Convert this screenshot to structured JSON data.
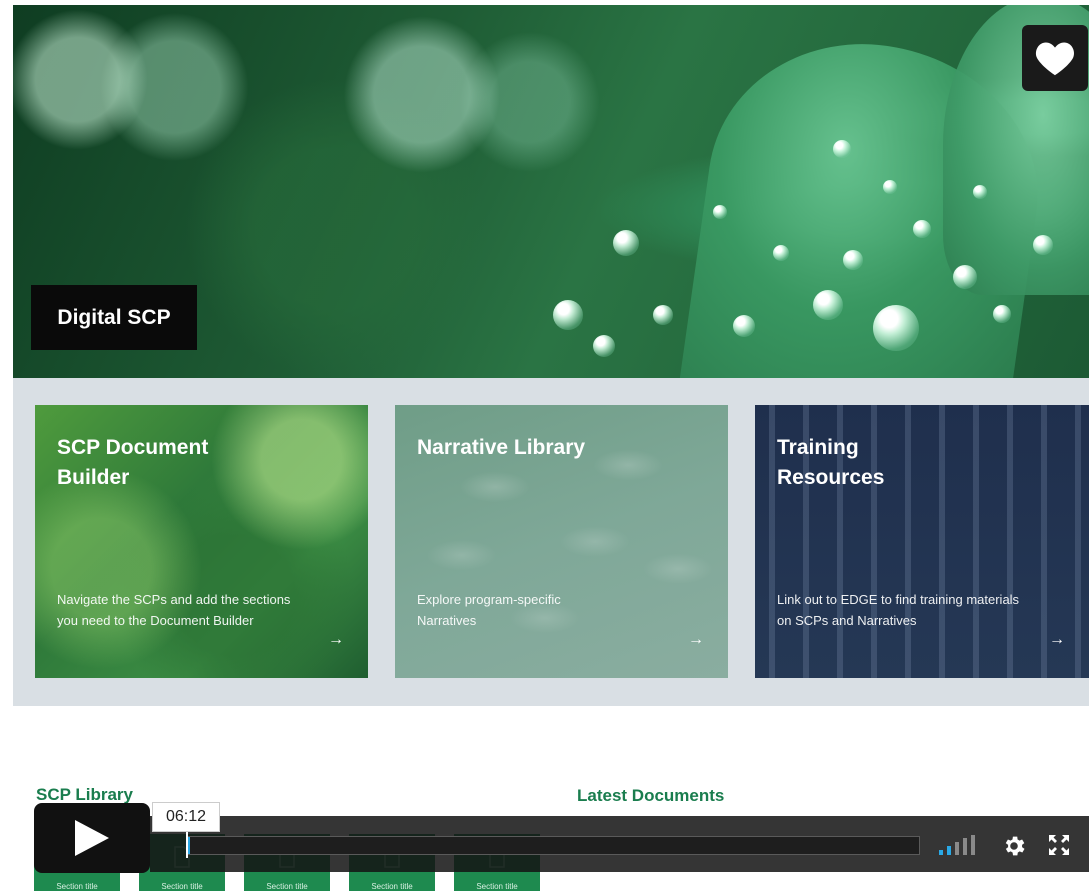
{
  "hero": {
    "title": "Digital SCP",
    "like_icon": "heart-icon"
  },
  "cards": [
    {
      "title": "SCP Document Builder",
      "description": "Navigate the SCPs and add the sections you need to the Document Builder",
      "arrow": "→"
    },
    {
      "title": "Narrative Library",
      "description": "Explore program-specific Narratives",
      "arrow": "→"
    },
    {
      "title": "Training Resources",
      "description": "Link out to EDGE to find training materials on SCPs and Narratives",
      "arrow": "→"
    }
  ],
  "library": {
    "heading": "SCP Library",
    "tiles": [
      "Section title",
      "Section title",
      "Section title",
      "Section title",
      "Section title"
    ]
  },
  "latest": {
    "heading": "Latest Documents"
  },
  "player": {
    "time": "06:12",
    "progress": 0.002,
    "volume_level": 0.4,
    "accent_color": "#2aa9e6",
    "icons": [
      "play-icon",
      "volume-icon",
      "gear-icon",
      "fullscreen-icon"
    ]
  }
}
